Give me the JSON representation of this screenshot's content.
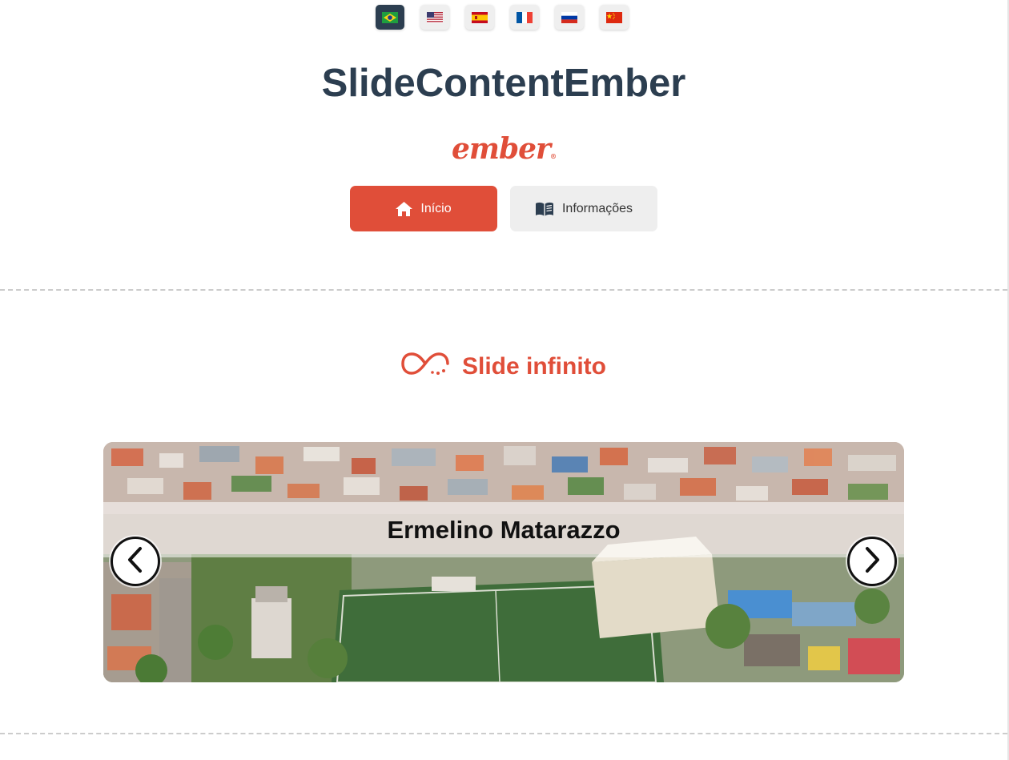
{
  "app": {
    "title": "SlideContentEmber",
    "logo_text": "ember",
    "logo_mark": "®"
  },
  "languages": [
    {
      "code": "pt-BR",
      "icon": "brazil-flag-icon",
      "active": true
    },
    {
      "code": "en-US",
      "icon": "usa-flag-icon",
      "active": false
    },
    {
      "code": "es",
      "icon": "spain-flag-icon",
      "active": false
    },
    {
      "code": "fr",
      "icon": "france-flag-icon",
      "active": false
    },
    {
      "code": "ru",
      "icon": "russia-flag-icon",
      "active": false
    },
    {
      "code": "zh",
      "icon": "china-flag-icon",
      "active": false
    }
  ],
  "nav": {
    "home_label": "Início",
    "home_icon": "home-icon",
    "info_label": "Informações",
    "info_icon": "book-icon"
  },
  "section": {
    "title": "Slide infinito",
    "icon": "infinity-icon"
  },
  "slider": {
    "caption": "Ermelino Matarazzo",
    "prev_icon": "chevron-left-icon",
    "next_icon": "chevron-right-icon"
  },
  "colors": {
    "accent": "#e04e39",
    "title": "#2c3e50",
    "secondary_button": "#eeeeee"
  }
}
